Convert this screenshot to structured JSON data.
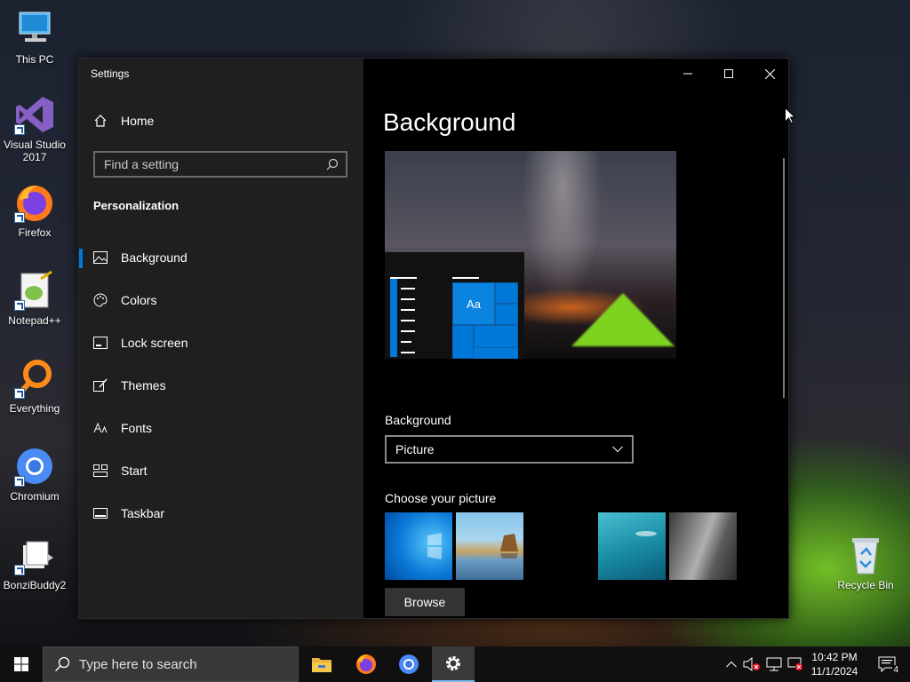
{
  "desktop": {
    "icons": [
      {
        "label": "This PC"
      },
      {
        "label": "Visual Studio 2017"
      },
      {
        "label": "Firefox"
      },
      {
        "label": "Notepad++"
      },
      {
        "label": "Everything"
      },
      {
        "label": "Chromium"
      },
      {
        "label": "BonziBuddy2"
      },
      {
        "label": "Recycle Bin"
      }
    ]
  },
  "settings": {
    "window_title": "Settings",
    "home_label": "Home",
    "search_placeholder": "Find a setting",
    "section_title": "Personalization",
    "nav_items": [
      {
        "label": "Background",
        "active": true
      },
      {
        "label": "Colors"
      },
      {
        "label": "Lock screen"
      },
      {
        "label": "Themes"
      },
      {
        "label": "Fonts"
      },
      {
        "label": "Start"
      },
      {
        "label": "Taskbar"
      }
    ],
    "page_title": "Background",
    "preview_tile_text": "Aa",
    "background_label": "Background",
    "background_value": "Picture",
    "choose_label": "Choose your picture",
    "browse_label": "Browse",
    "accent_color": "#0078d7"
  },
  "taskbar": {
    "search_placeholder": "Type here to search",
    "time": "10:42 PM",
    "date": "11/1/2024",
    "notification_count": "4"
  }
}
